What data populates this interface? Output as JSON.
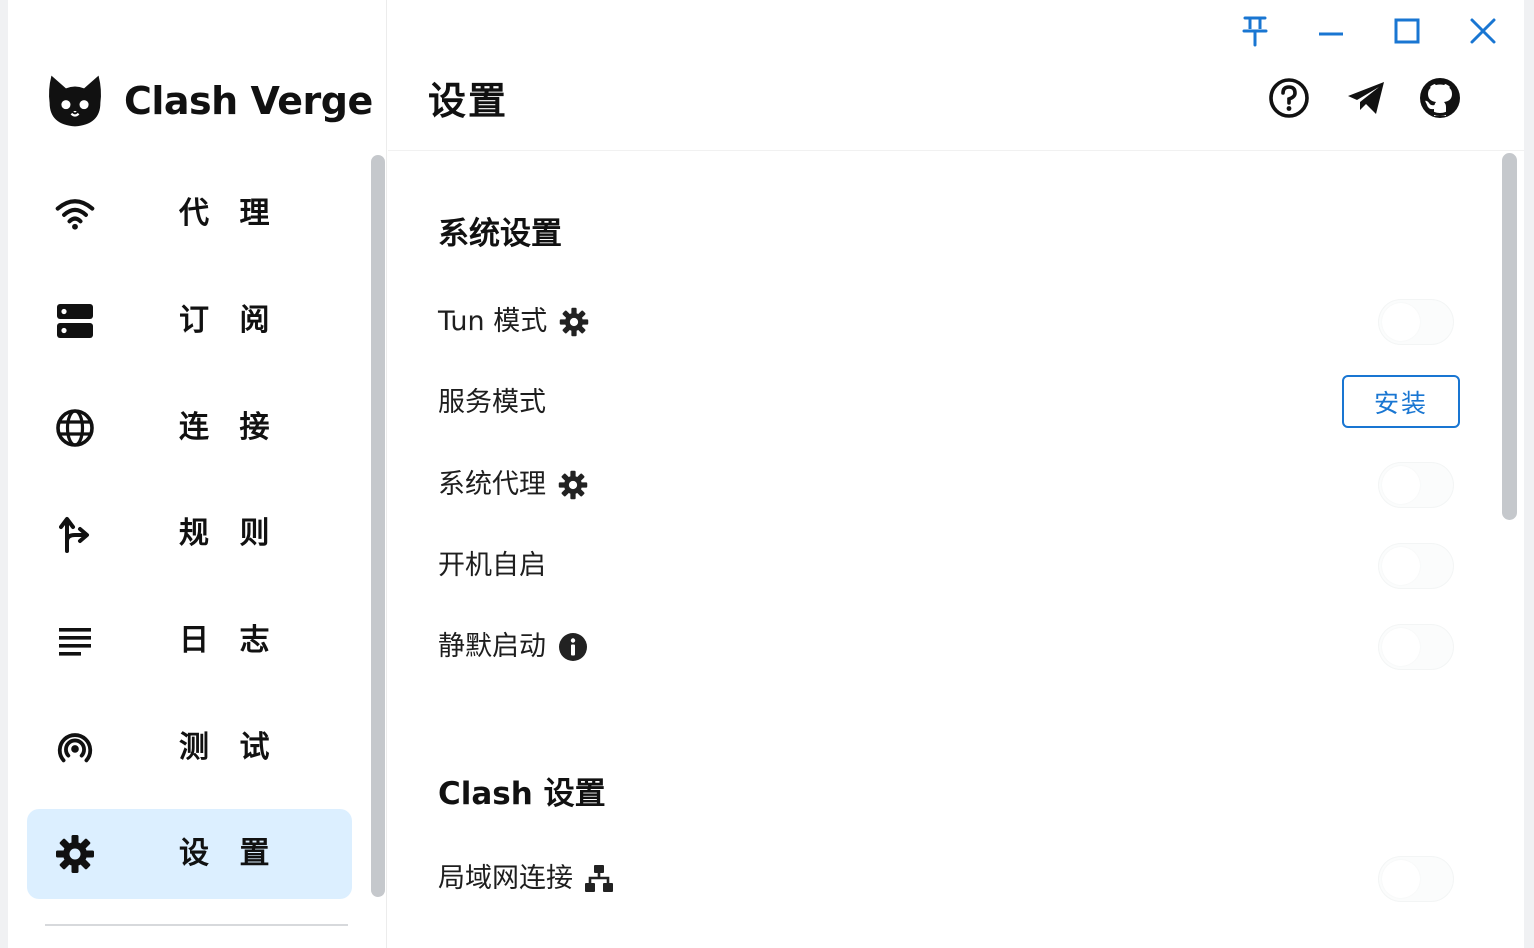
{
  "app": {
    "name": "Clash Verge"
  },
  "window_controls": [
    {
      "name": "pin-icon"
    },
    {
      "name": "minimize-icon"
    },
    {
      "name": "maximize-icon"
    },
    {
      "name": "close-icon"
    }
  ],
  "header": {
    "title": "设置",
    "icons": [
      "help-icon",
      "telegram-icon",
      "github-icon"
    ]
  },
  "sidebar": {
    "items": [
      {
        "label": "代 理",
        "icon": "wifi-icon",
        "active": false
      },
      {
        "label": "订 阅",
        "icon": "server-icon",
        "active": false
      },
      {
        "label": "连 接",
        "icon": "globe-icon",
        "active": false
      },
      {
        "label": "规 则",
        "icon": "route-fork-icon",
        "active": false
      },
      {
        "label": "日 志",
        "icon": "lines-icon",
        "active": false
      },
      {
        "label": "测 试",
        "icon": "broadcast-icon",
        "active": false
      },
      {
        "label": "设 置",
        "icon": "gear-icon",
        "active": true
      }
    ]
  },
  "settings": {
    "system_section": {
      "title": "系统设置",
      "rows": [
        {
          "label": "Tun 模式",
          "icon": "gear-icon",
          "control": "toggle",
          "on": false
        },
        {
          "label": "服务模式",
          "control": "button",
          "button_label": "安装"
        },
        {
          "label": "系统代理",
          "icon": "gear-icon",
          "control": "toggle",
          "on": false
        },
        {
          "label": "开机自启",
          "control": "toggle",
          "on": false
        },
        {
          "label": "静默启动",
          "icon": "info-icon",
          "control": "toggle",
          "on": false
        }
      ]
    },
    "clash_section": {
      "title": "Clash 设置",
      "rows": [
        {
          "label": "局域网连接",
          "icon": "network-icon",
          "control": "toggle",
          "on": false
        }
      ]
    }
  },
  "colors": {
    "accent": "#1976d2",
    "active_nav_bg": "#dcefff",
    "scrollbar": "#c5c8cc"
  }
}
